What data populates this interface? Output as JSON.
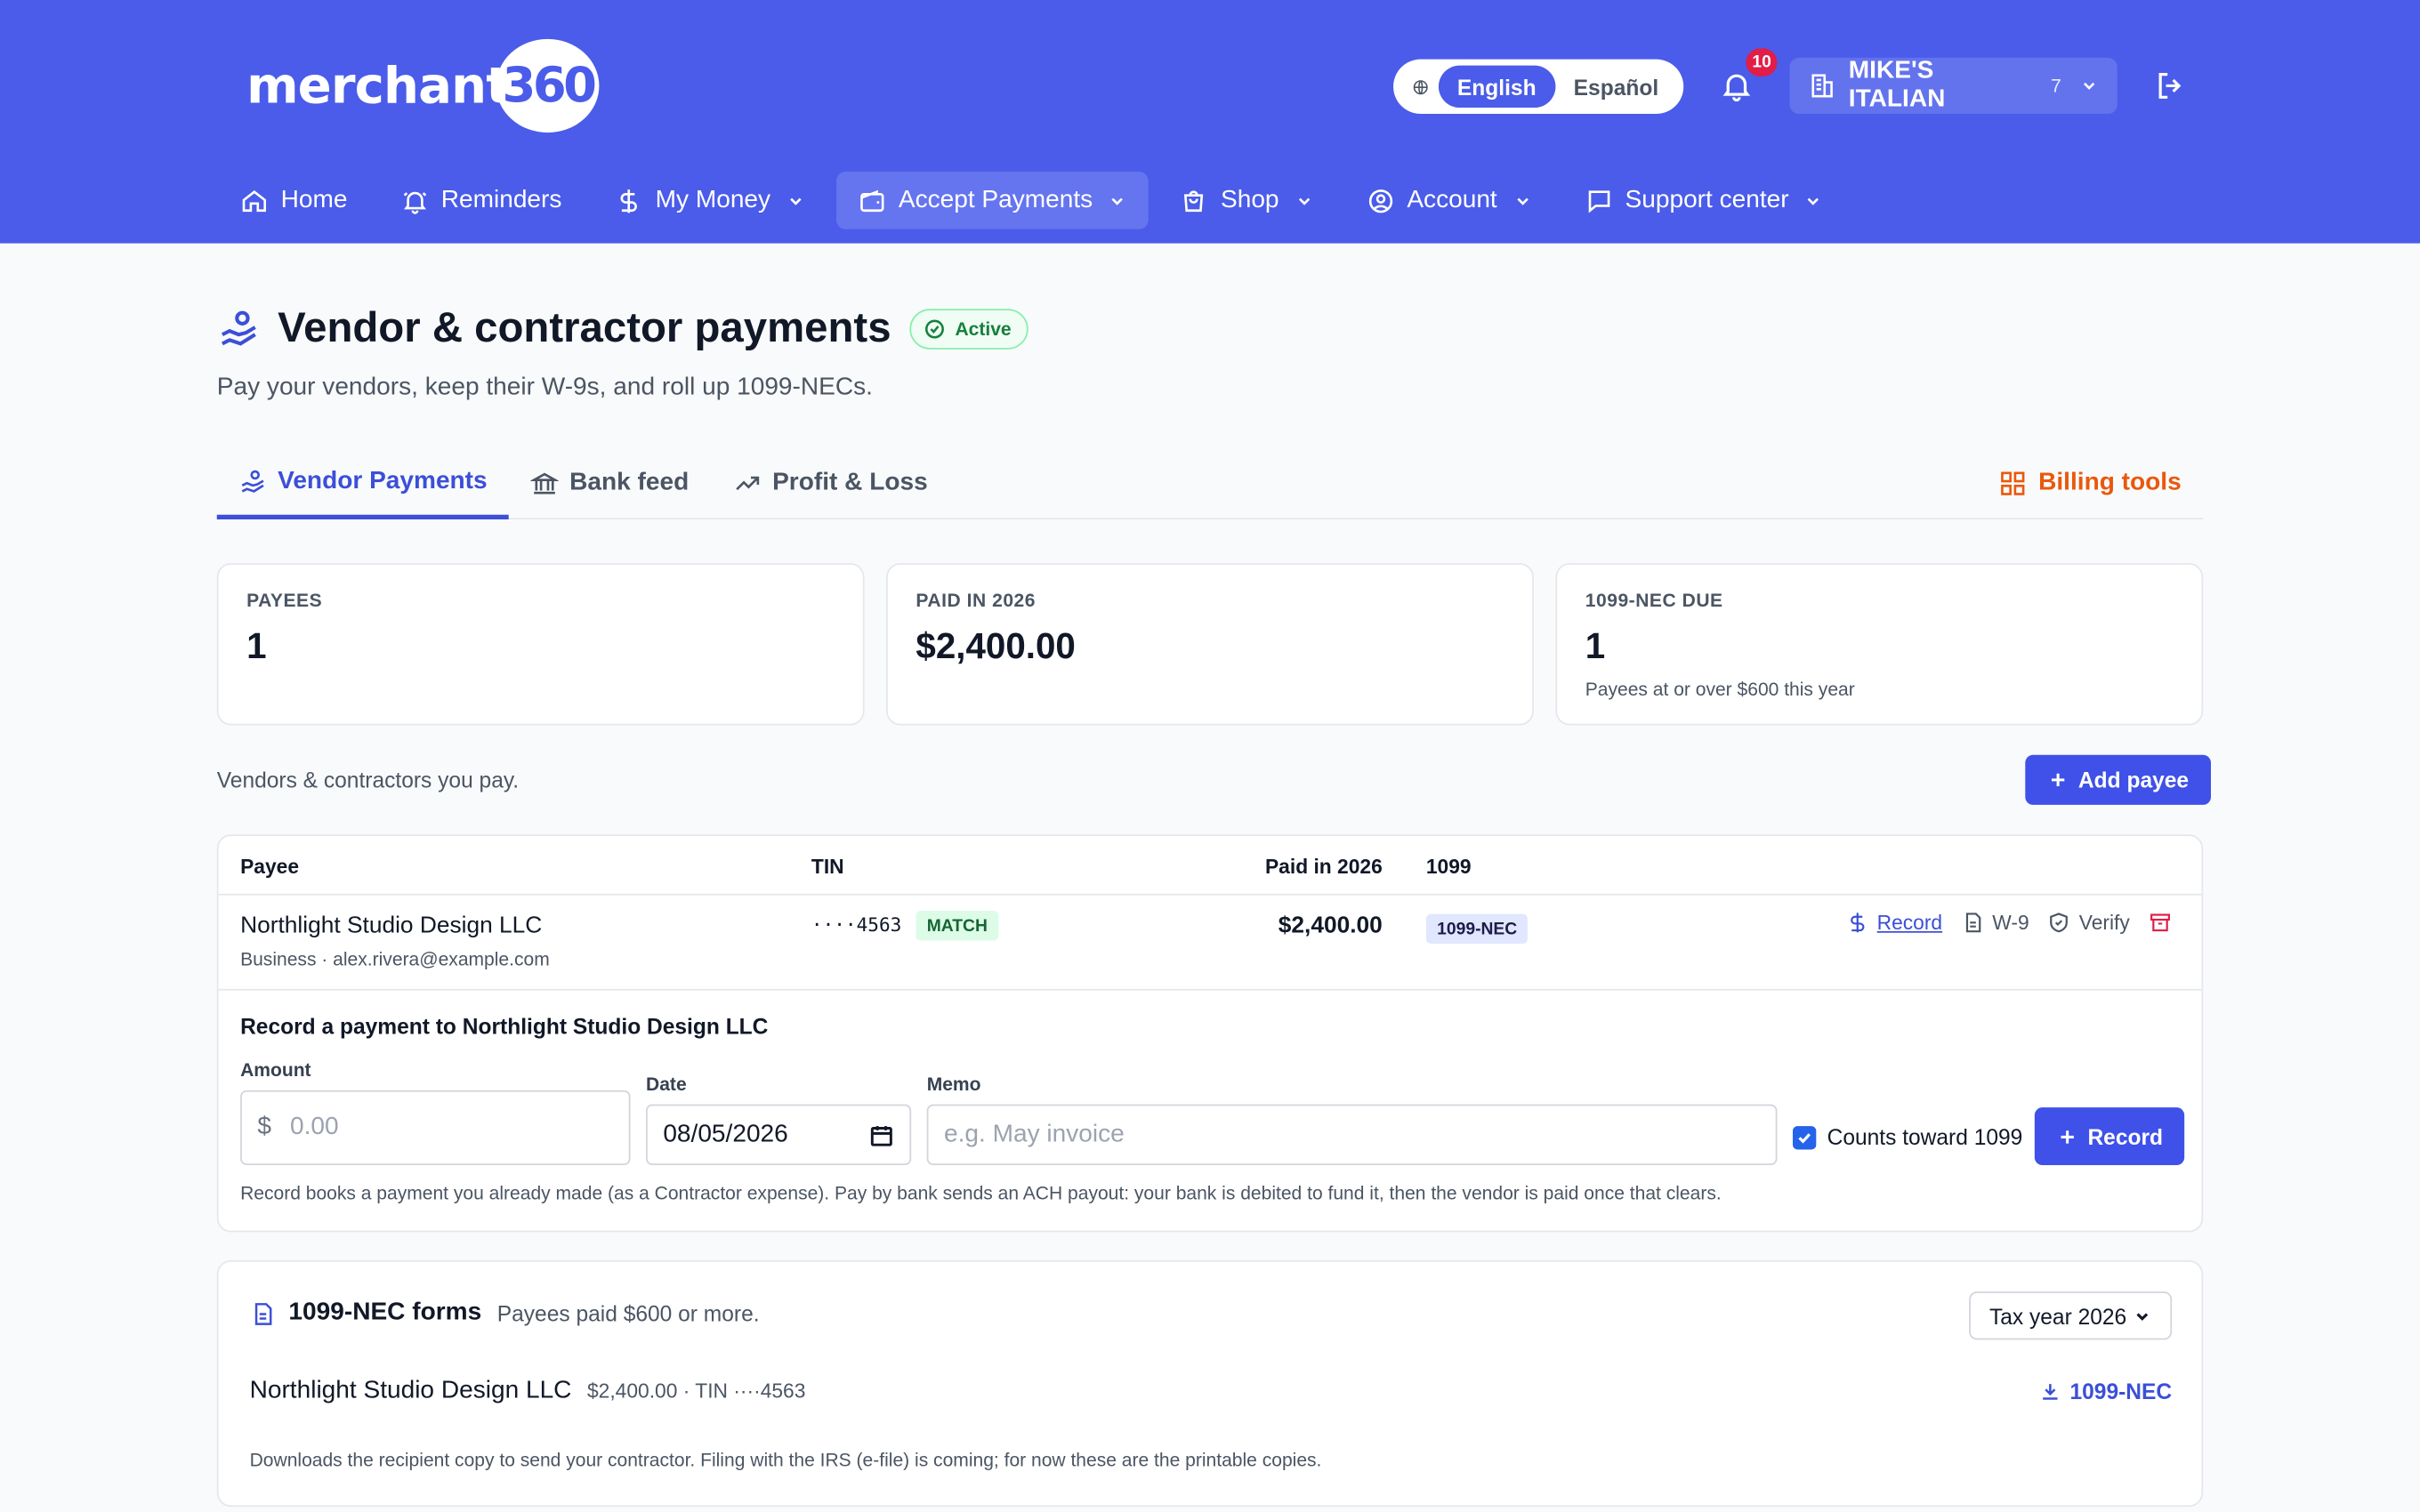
{
  "brand": {
    "logo_text": "merchant",
    "logo_badge": "360",
    "primary": "#4a5ce9",
    "accent_orange": "#ea580c"
  },
  "header": {
    "languages": [
      {
        "label": "English",
        "active": true
      },
      {
        "label": "Español",
        "active": false
      }
    ],
    "notifications_count": "10",
    "merchant_name": "MIKE'S ITALIAN",
    "merchant_count": "7"
  },
  "nav": [
    {
      "label": "Home",
      "icon": "home-icon"
    },
    {
      "label": "Reminders",
      "icon": "bell-icon"
    },
    {
      "label": "My Money",
      "icon": "dollar-icon",
      "dropdown": true
    },
    {
      "label": "Accept Payments",
      "icon": "wallet-icon",
      "dropdown": true,
      "active": true
    },
    {
      "label": "Shop",
      "icon": "bag-icon",
      "dropdown": true
    },
    {
      "label": "Account",
      "icon": "user-circle-icon",
      "dropdown": true
    },
    {
      "label": "Support center",
      "icon": "chat-icon",
      "dropdown": true
    }
  ],
  "page": {
    "title": "Vendor & contractor payments",
    "status": "Active",
    "subtitle": "Pay your vendors, keep their W-9s, and roll up 1099-NECs."
  },
  "tabs": [
    {
      "label": "Vendor Payments",
      "active": true
    },
    {
      "label": "Bank feed"
    },
    {
      "label": "Profit & Loss"
    }
  ],
  "billing_tools_label": "Billing tools",
  "stats": [
    {
      "label": "PAYEES",
      "value": "1",
      "note": ""
    },
    {
      "label": "PAID IN 2026",
      "value": "$2,400.00",
      "note": ""
    },
    {
      "label": "1099-NEC DUE",
      "value": "1",
      "note": "Payees at or over $600 this year"
    }
  ],
  "list_caption": "Vendors & contractors you pay.",
  "add_payee_label": "Add payee",
  "table": {
    "headers": {
      "payee": "Payee",
      "tin": "TIN",
      "paid": "Paid in 2026",
      "form": "1099"
    },
    "row": {
      "name": "Northlight Studio Design LLC",
      "meta": "Business · alex.rivera@example.com",
      "tin": "····4563",
      "tin_status": "MATCH",
      "paid": "$2,400.00",
      "form": "1099-NEC",
      "actions": {
        "record": "Record",
        "w9": "W-9",
        "verify": "Verify"
      }
    }
  },
  "record_form": {
    "title": "Record a payment to Northlight Studio Design LLC",
    "amount_label": "Amount",
    "amount_prefix": "$",
    "amount_placeholder": "0.00",
    "date_label": "Date",
    "date_value": "08/05/2026",
    "memo_label": "Memo",
    "memo_placeholder": "e.g. May invoice",
    "counts_label": "Counts toward 1099",
    "counts_checked": true,
    "submit_label": "Record",
    "note": "Record books a payment you already made (as a Contractor expense). Pay by bank sends an ACH payout: your bank is debited to fund it, then the vendor is paid once that clears."
  },
  "forms": {
    "title": "1099-NEC forms",
    "subtitle": "Payees paid $600 or more.",
    "tax_year": "Tax year 2026",
    "payee_name": "Northlight Studio Design LLC",
    "payee_meta": "$2,400.00 · TIN ····4563",
    "download_label": "1099-NEC",
    "note": "Downloads the recipient copy to send your contractor. Filing with the IRS (e-file) is coming; for now these are the printable copies."
  }
}
